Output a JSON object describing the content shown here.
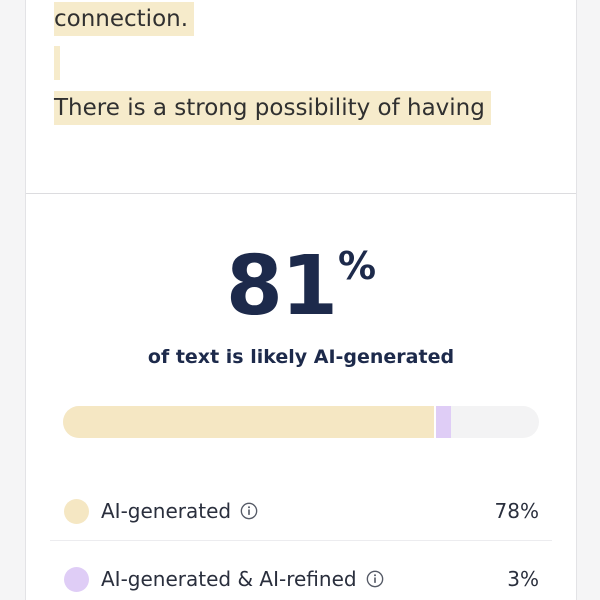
{
  "document": {
    "lines": [
      "connection.",
      "There is a strong possibility of having"
    ]
  },
  "score": {
    "value": "81",
    "unit": "%",
    "caption": "of text is likely AI-generated"
  },
  "bar": {
    "ai_generated_fraction": 0.78,
    "ai_refined_fraction": 0.03
  },
  "breakdown": [
    {
      "label": "AI-generated",
      "value": "78%",
      "color": "#f5e7c3"
    },
    {
      "label": "AI-generated & AI-refined",
      "value": "3%",
      "color": "#dfcdf6"
    }
  ],
  "icons": {
    "info": "info-icon"
  },
  "colors": {
    "highlight": "#f6ebcb",
    "score_text": "#1d2a4b"
  }
}
